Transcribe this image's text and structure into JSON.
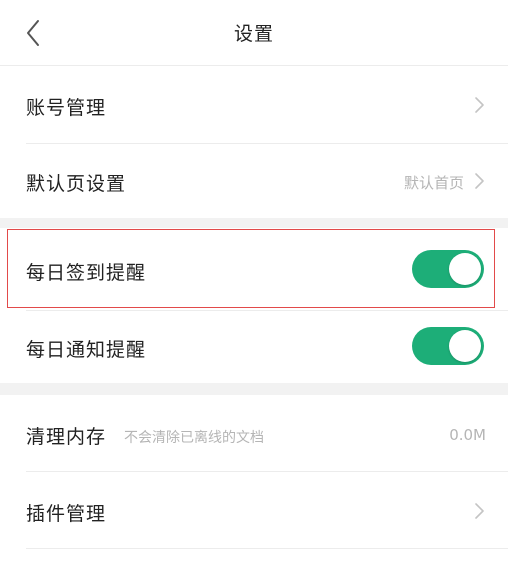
{
  "header": {
    "back_icon": "chevron-left-icon",
    "title": "设置"
  },
  "colors": {
    "toggle_on": "#1dae78",
    "highlight_border": "#e24a4a",
    "section_gap": "#f2f2f2"
  },
  "rows": {
    "account": {
      "label": "账号管理",
      "icon": "chevron-right-icon"
    },
    "default_page": {
      "label": "默认页设置",
      "value": "默认首页",
      "icon": "chevron-right-icon"
    },
    "daily_checkin": {
      "label": "每日签到提醒",
      "toggle_on": true
    },
    "daily_notify": {
      "label": "每日通知提醒",
      "toggle_on": true
    },
    "clear_cache": {
      "label": "清理内存",
      "sub": "不会清除已离线的文档",
      "value": "0.0M"
    },
    "plugins": {
      "label": "插件管理",
      "icon": "chevron-right-icon"
    }
  }
}
